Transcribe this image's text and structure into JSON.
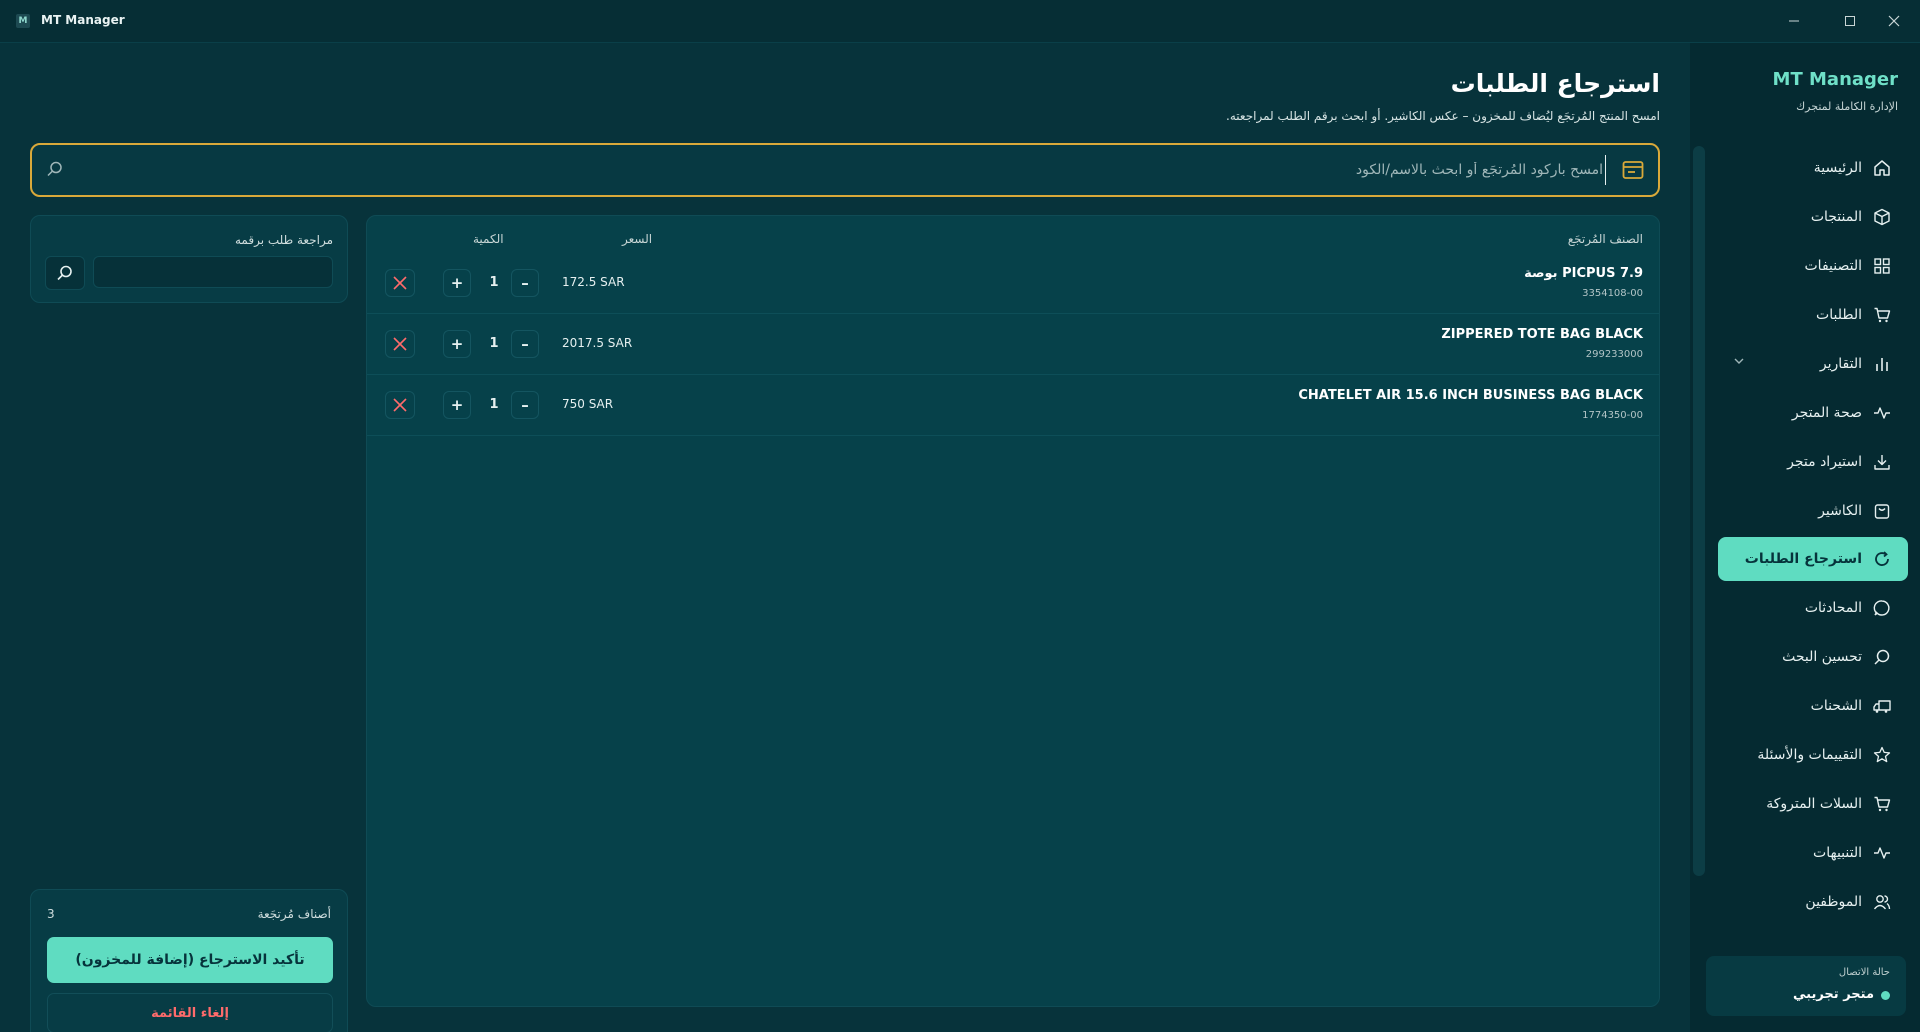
{
  "window": {
    "title": "MT Manager",
    "logo_text": "M"
  },
  "page": {
    "title": "استرجاع الطلبات",
    "subtitle": "امسح المنتج المُرتجَع ليُضاف للمخزون – عكس الكاشير. أو ابحث برقم الطلب لمراجعته."
  },
  "scan": {
    "placeholder": "امسح باركود المُرتجَع أو ابحث بالاسم/الكود",
    "value": ""
  },
  "lookup": {
    "label": "مراجعة طلب برقمه",
    "value": ""
  },
  "table": {
    "headers": {
      "item": "الصنف المُرتجَع",
      "price": "السعر",
      "qty": "الكمية"
    },
    "rows": [
      {
        "name": "PICPUS 7.9 بوصة",
        "sku": "3354108-00",
        "price": "172.5 SAR",
        "qty": "1"
      },
      {
        "name": "ZIPPERED TOTE BAG BLACK",
        "sku": "299233000",
        "price": "2017.5 SAR",
        "qty": "1"
      },
      {
        "name": "CHATELET AIR 15.6 INCH BUSINESS BAG BLACK",
        "sku": "1774350-00",
        "price": "750 SAR",
        "qty": "1"
      }
    ]
  },
  "summary": {
    "label": "أصناف مُرتجَعة",
    "count": "3",
    "confirm": "تأكيد الاسترجاع (إضافة للمخزون)",
    "cancel": "إلغاء القائمة"
  },
  "sidebar": {
    "brand": "MT Manager",
    "tagline": "الإدارة الكاملة لمتجرك",
    "items": [
      {
        "label": "الرئيسية",
        "icon": "home-icon"
      },
      {
        "label": "المنتجات",
        "icon": "box-icon"
      },
      {
        "label": "التصنيفات",
        "icon": "grid-icon"
      },
      {
        "label": "الطلبات",
        "icon": "cart-icon"
      },
      {
        "label": "التقارير",
        "icon": "bar-chart-icon"
      },
      {
        "label": "صحة المتجر",
        "icon": "pulse-icon"
      },
      {
        "label": "استيراد متجر",
        "icon": "download-icon"
      },
      {
        "label": "الكاشير",
        "icon": "bag-icon"
      },
      {
        "label": "استرجاع الطلبات",
        "icon": "refresh-icon",
        "active": true
      },
      {
        "label": "المحادثات",
        "icon": "chat-icon"
      },
      {
        "label": "تحسين البحث",
        "icon": "search-icon"
      },
      {
        "label": "الشحنات",
        "icon": "truck-icon"
      },
      {
        "label": "التقييمات والأسئلة",
        "icon": "star-icon"
      },
      {
        "label": "السلات المتروكة",
        "icon": "cart-icon"
      },
      {
        "label": "التنبيهات",
        "icon": "pulse-icon"
      },
      {
        "label": "الموظفين",
        "icon": "users-icon"
      }
    ],
    "connection": {
      "label": "حالة الاتصال",
      "status": "متجر تجريبي"
    }
  },
  "colors": {
    "accent": "#5fdcc1",
    "scan_border": "#d9a93a",
    "danger": "#ff6b6b",
    "bg": "#07333b"
  }
}
